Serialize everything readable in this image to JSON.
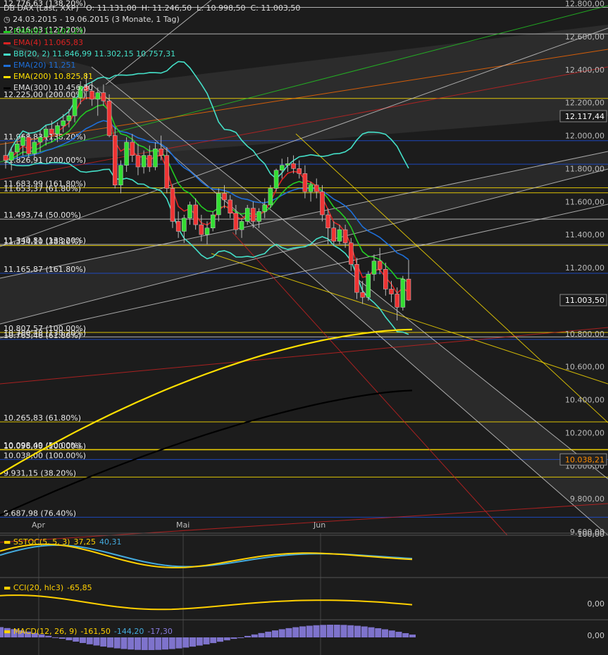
{
  "chart_data": {
    "type": "candlestick",
    "instrument": "DB DAX (Last, XXP)",
    "ohlc_header": {
      "O": "11.131,00",
      "H": "11.246,50",
      "L": "10.998,50",
      "C": "11.003,50"
    },
    "period_text": "24.03.2015 - 19.06.2015 (3 Monate, 1 Tag)",
    "x_tick_labels": [
      "Apr",
      "Mai",
      "Jun"
    ],
    "y_tick_labels": [
      "12.800,00",
      "12.600,00",
      "12.400,00",
      "12.200,00",
      "12.000,00",
      "11.800,00",
      "11.600,00",
      "11.400,00",
      "11.200,00",
      "10.800,00",
      "10.600,00",
      "10.400,00",
      "10.200,00",
      "10.000,00",
      "9.800,00",
      "9.600,00"
    ],
    "ylim": [
      9600,
      12800
    ],
    "price_tags": [
      {
        "label": "12.117,44",
        "value": 12117.44,
        "color": "#ffffff",
        "bg": "#1c1c1c"
      },
      {
        "label": "11.003,50",
        "value": 11003.5,
        "color": "#ffffff",
        "bg": "#1c1c1c"
      },
      {
        "label": "10.038,21",
        "value": 10038.21,
        "color": "#ff8c00",
        "bg": "#222222"
      }
    ],
    "legend": [
      {
        "text": "EMA(9)  11.107,23",
        "color": "#22cc22"
      },
      {
        "text": "EMA(4)  11.065,83",
        "color": "#dd2222"
      },
      {
        "text": "BB(20, 2)  11.846,99  11.302,15  10.757,31",
        "color": "#44e0c8"
      },
      {
        "text": "EMA(20)  11.251",
        "color": "#1e6fd9"
      },
      {
        "text": "EMA(200)  10.825,81",
        "color": "#ffe000"
      },
      {
        "text": "EMA(300)  10.456,30",
        "color": "#000000"
      }
    ],
    "fib_levels": [
      {
        "label": "12.776,63 (138.20%)",
        "value": 12776.63,
        "color": "#cccccc"
      },
      {
        "label": "12.616,03 (127.20%)",
        "value": 12616.03,
        "color": "#cccccc"
      },
      {
        "label": "12.225,00 (200.00%)",
        "value": 12225.0,
        "color": "#ffe000"
      },
      {
        "label": "11.968,83 (138.20%)",
        "value": 11968.83,
        "color": "#1e4fd9"
      },
      {
        "label": "11.826,91 (200.00%)",
        "value": 11826.91,
        "color": "#1e4fd9"
      },
      {
        "label": "11.683,99 (161.80%)",
        "value": 11683.99,
        "color": "#ffe000"
      },
      {
        "label": "11.653,37 (61.80%)",
        "value": 11653.37,
        "color": "#ffe000"
      },
      {
        "label": "11.493,74 (50.00%)",
        "value": 11493.74,
        "color": "#cccccc"
      },
      {
        "label": "11.340,81 (138.20%)",
        "value": 11340.81,
        "color": "#cccccc"
      },
      {
        "label": "11.334,10 (38.20%)",
        "value": 11334.1,
        "color": "#ffe000"
      },
      {
        "label": "11.165,87 (161.80%)",
        "value": 11165.87,
        "color": "#1e4fd9"
      },
      {
        "label": "10.807,57 (100.00%)",
        "value": 10807.57,
        "color": "#ffe000"
      },
      {
        "label": "10.780,48 (138.20%)",
        "value": 10780.48,
        "color": "#cccccc"
      },
      {
        "label": "10.765,46 (61.80%)",
        "value": 10765.46,
        "color": "#1e4fd9"
      },
      {
        "label": "10.265,83 (61.80%)",
        "value": 10265.83,
        "color": "#ffe000"
      },
      {
        "label": "10.098,49 (50.00%)",
        "value": 10098.49,
        "color": "#ffe000"
      },
      {
        "label": "10.096,00 (100.00%)",
        "value": 10096.0,
        "color": "#ffe000"
      },
      {
        "label": "10.038,00 (100.00%)",
        "value": 10038.0,
        "color": "#1e4fd9"
      },
      {
        "label": "9.931,15 (38.20%)",
        "value": 9931.15,
        "color": "#ffe000"
      },
      {
        "label": "9.687,98 (76.40%)",
        "value": 9687.98,
        "color": "#1e4fd9"
      }
    ],
    "candles": [
      {
        "o": 11880,
        "h": 11960,
        "l": 11800,
        "c": 11850
      },
      {
        "o": 11850,
        "h": 11930,
        "l": 11790,
        "c": 11900
      },
      {
        "o": 11900,
        "h": 11990,
        "l": 11860,
        "c": 11950
      },
      {
        "o": 11940,
        "h": 12010,
        "l": 11880,
        "c": 11990
      },
      {
        "o": 11990,
        "h": 12020,
        "l": 11870,
        "c": 11890
      },
      {
        "o": 11890,
        "h": 11990,
        "l": 11860,
        "c": 11960
      },
      {
        "o": 11960,
        "h": 12030,
        "l": 11900,
        "c": 11990
      },
      {
        "o": 11990,
        "h": 12060,
        "l": 11940,
        "c": 12040
      },
      {
        "o": 12040,
        "h": 12090,
        "l": 11960,
        "c": 12010
      },
      {
        "o": 12010,
        "h": 12080,
        "l": 11960,
        "c": 12060
      },
      {
        "o": 12060,
        "h": 12130,
        "l": 12020,
        "c": 12090
      },
      {
        "o": 12090,
        "h": 12160,
        "l": 12050,
        "c": 12120
      },
      {
        "o": 12120,
        "h": 12250,
        "l": 12080,
        "c": 12230
      },
      {
        "o": 12230,
        "h": 12330,
        "l": 12190,
        "c": 12300
      },
      {
        "o": 12300,
        "h": 12380,
        "l": 12220,
        "c": 12270
      },
      {
        "o": 12270,
        "h": 12330,
        "l": 12180,
        "c": 12220
      },
      {
        "o": 12220,
        "h": 12290,
        "l": 12120,
        "c": 12260
      },
      {
        "o": 12260,
        "h": 12310,
        "l": 12180,
        "c": 12210
      },
      {
        "o": 12210,
        "h": 12250,
        "l": 11990,
        "c": 12000
      },
      {
        "o": 12000,
        "h": 12050,
        "l": 11680,
        "c": 11700
      },
      {
        "o": 11700,
        "h": 11850,
        "l": 11650,
        "c": 11820
      },
      {
        "o": 11820,
        "h": 11990,
        "l": 11780,
        "c": 11960
      },
      {
        "o": 11960,
        "h": 12010,
        "l": 11840,
        "c": 11880
      },
      {
        "o": 11880,
        "h": 11950,
        "l": 11760,
        "c": 11810
      },
      {
        "o": 11810,
        "h": 11910,
        "l": 11770,
        "c": 11880
      },
      {
        "o": 11880,
        "h": 11940,
        "l": 11780,
        "c": 11810
      },
      {
        "o": 11810,
        "h": 11960,
        "l": 11790,
        "c": 11920
      },
      {
        "o": 11920,
        "h": 12000,
        "l": 11850,
        "c": 11880
      },
      {
        "o": 11880,
        "h": 11930,
        "l": 11650,
        "c": 11680
      },
      {
        "o": 11680,
        "h": 11700,
        "l": 11440,
        "c": 11480
      },
      {
        "o": 11480,
        "h": 11540,
        "l": 11380,
        "c": 11420
      },
      {
        "o": 11420,
        "h": 11520,
        "l": 11350,
        "c": 11500
      },
      {
        "o": 11500,
        "h": 11600,
        "l": 11460,
        "c": 11580
      },
      {
        "o": 11580,
        "h": 11620,
        "l": 11430,
        "c": 11460
      },
      {
        "o": 11460,
        "h": 11520,
        "l": 11360,
        "c": 11400
      },
      {
        "o": 11400,
        "h": 11480,
        "l": 11340,
        "c": 11440
      },
      {
        "o": 11440,
        "h": 11540,
        "l": 11420,
        "c": 11520
      },
      {
        "o": 11520,
        "h": 11680,
        "l": 11480,
        "c": 11650
      },
      {
        "o": 11650,
        "h": 11700,
        "l": 11560,
        "c": 11610
      },
      {
        "o": 11610,
        "h": 11640,
        "l": 11500,
        "c": 11530
      },
      {
        "o": 11530,
        "h": 11580,
        "l": 11400,
        "c": 11430
      },
      {
        "o": 11430,
        "h": 11500,
        "l": 11380,
        "c": 11480
      },
      {
        "o": 11480,
        "h": 11580,
        "l": 11460,
        "c": 11560
      },
      {
        "o": 11560,
        "h": 11600,
        "l": 11440,
        "c": 11480
      },
      {
        "o": 11480,
        "h": 11560,
        "l": 11440,
        "c": 11540
      },
      {
        "o": 11540,
        "h": 11620,
        "l": 11500,
        "c": 11580
      },
      {
        "o": 11580,
        "h": 11700,
        "l": 11560,
        "c": 11680
      },
      {
        "o": 11680,
        "h": 11800,
        "l": 11660,
        "c": 11790
      },
      {
        "o": 11790,
        "h": 11860,
        "l": 11740,
        "c": 11820
      },
      {
        "o": 11820,
        "h": 11870,
        "l": 11780,
        "c": 11830
      },
      {
        "o": 11830,
        "h": 11880,
        "l": 11770,
        "c": 11800
      },
      {
        "o": 11800,
        "h": 11850,
        "l": 11740,
        "c": 11770
      },
      {
        "o": 11770,
        "h": 11820,
        "l": 11620,
        "c": 11660
      },
      {
        "o": 11660,
        "h": 11720,
        "l": 11600,
        "c": 11700
      },
      {
        "o": 11700,
        "h": 11740,
        "l": 11620,
        "c": 11660
      },
      {
        "o": 11660,
        "h": 11700,
        "l": 11480,
        "c": 11520
      },
      {
        "o": 11520,
        "h": 11560,
        "l": 11340,
        "c": 11440
      },
      {
        "o": 11440,
        "h": 11480,
        "l": 11330,
        "c": 11360
      },
      {
        "o": 11360,
        "h": 11460,
        "l": 11340,
        "c": 11430
      },
      {
        "o": 11430,
        "h": 11460,
        "l": 11320,
        "c": 11350
      },
      {
        "o": 11350,
        "h": 11380,
        "l": 11180,
        "c": 11220
      },
      {
        "o": 11220,
        "h": 11260,
        "l": 11010,
        "c": 11050
      },
      {
        "o": 11050,
        "h": 11120,
        "l": 10980,
        "c": 11020
      },
      {
        "o": 11020,
        "h": 11180,
        "l": 11000,
        "c": 11160
      },
      {
        "o": 11160,
        "h": 11280,
        "l": 11120,
        "c": 11240
      },
      {
        "o": 11240,
        "h": 11320,
        "l": 11160,
        "c": 11190
      },
      {
        "o": 11190,
        "h": 11230,
        "l": 11030,
        "c": 11070
      },
      {
        "o": 11070,
        "h": 11120,
        "l": 10990,
        "c": 11040
      },
      {
        "o": 11040,
        "h": 11080,
        "l": 10880,
        "c": 10960
      },
      {
        "o": 10960,
        "h": 11150,
        "l": 10940,
        "c": 11130
      },
      {
        "o": 11131,
        "h": 11246.5,
        "l": 10998.5,
        "c": 11003.5
      }
    ],
    "sstoc": {
      "label": "SSTOC(5, 5, 3)",
      "value1": "37,25",
      "value2": "40,31"
    },
    "cci": {
      "label": "CCI(20, hlc3)",
      "value": "-65,85",
      "axis_label": "0,00"
    },
    "macd": {
      "label": "MACD(12, 26, 9)",
      "value1": "-161,50",
      "value2": "-144,20",
      "value3": "-17,30",
      "axis_label": "0,00"
    },
    "sstoc_axis_label": "100,00"
  }
}
